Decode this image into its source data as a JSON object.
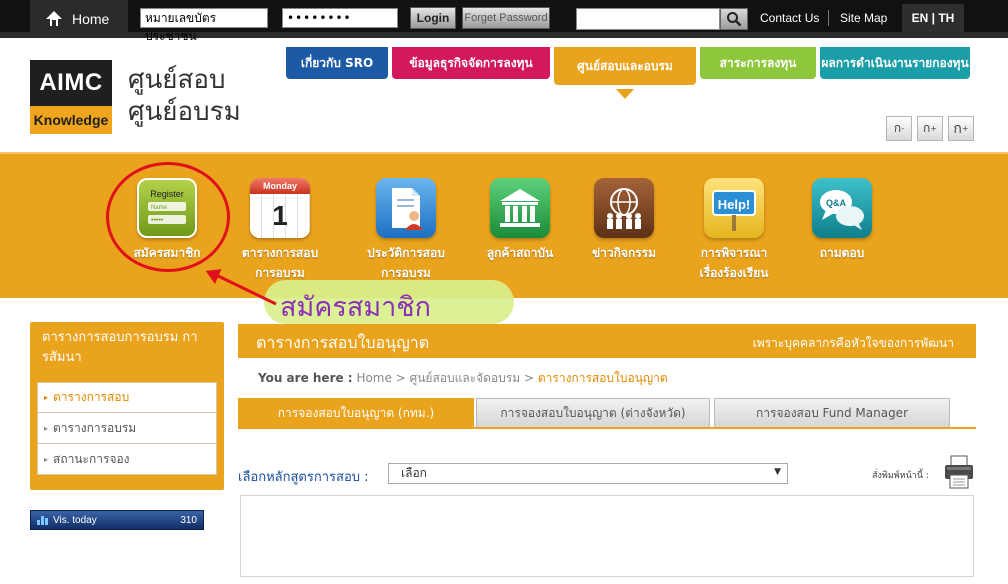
{
  "topbar": {
    "home_label": "Home",
    "id_input_value": "หมายเลขบัตรประชาชน",
    "password_value": "••••••••",
    "login_label": "Login",
    "forgot_label": "Forget Password",
    "search_value": "",
    "contact_label": "Contact Us",
    "sitemap_label": "Site Map",
    "lang_label": "EN | TH"
  },
  "header": {
    "logo_top": "AIMC",
    "logo_bottom": "Knowledge",
    "title_line1": "ศูนย์สอบ",
    "title_line2": "ศูนย์อบรม",
    "font_buttons": [
      "ก",
      "ก",
      "ก"
    ],
    "font_button_sup": [
      "-",
      "+",
      "+"
    ]
  },
  "nav": {
    "tabs": [
      {
        "label": "เกี่ยวกับ SRO",
        "color": "#1c5aa6"
      },
      {
        "label": "ข้อมูลธุรกิจจัดการลงทุน",
        "color": "#d3185c"
      },
      {
        "label": "ศูนย์สอบและอบรม",
        "color": "#eaa31d"
      },
      {
        "label": "สาระการลงทุน",
        "color": "#8ec73c"
      },
      {
        "label": "ผลการดำเนินงานรายกองทุน",
        "color": "#1b9ea8"
      }
    ]
  },
  "band": {
    "items": [
      {
        "label1": "สมัครสมาชิก",
        "label2": "",
        "icon": "register-icon",
        "icon_text": "Register",
        "icon_field1": "Name",
        "icon_field2": "•••••"
      },
      {
        "label1": "ตารางการสอบ",
        "label2": "การอบรม",
        "icon": "calendar-icon",
        "icon_text": "Monday",
        "icon_num": "1"
      },
      {
        "label1": "ประวัติการสอบ",
        "label2": "การอบรม",
        "icon": "history-document-icon"
      },
      {
        "label1": "ลูกค้าสถาบัน",
        "label2": "",
        "icon": "institution-icon"
      },
      {
        "label1": "ข่าวกิจกรรม",
        "label2": "",
        "icon": "globe-people-icon"
      },
      {
        "label1": "การพิจารณา",
        "label2": "เรื่องร้องเรียน",
        "icon": "help-sign-icon",
        "icon_text": "Help!"
      },
      {
        "label1": "ถามตอบ",
        "label2": "",
        "icon": "qa-chat-icon",
        "icon_text": "Q&A"
      }
    ],
    "annotation_text": "สมัครสมาชิก",
    "annotation_color": "#8b2fb6",
    "circle_color": "#e0101c"
  },
  "sidebar": {
    "title": "ตารางการสอบการอบรม การสัมนา",
    "items": [
      {
        "label": "ตารางการสอบ",
        "active": true
      },
      {
        "label": "ตารางการอบรม",
        "active": false
      },
      {
        "label": "สถานะการจอง",
        "active": false
      }
    ],
    "counter_label": "Vis. today",
    "counter_value": "310"
  },
  "main": {
    "title": "ตารางการสอบใบอนุญาต",
    "slogan": "เพราะบุคคลากรคือหัวใจของการพัฒนา",
    "breadcrumb": {
      "prefix": "You are here :",
      "items": [
        "Home",
        "ศูนย์สอบและจัดอบรม",
        "ตารางการสอบใบอนุญาต"
      ],
      "separator": ">"
    },
    "tabs": [
      {
        "label": "การจองสอบใบอนุญาต (กทม.)",
        "active": true
      },
      {
        "label": "การจองสอบใบอนุญาต (ต่างจังหวัด)",
        "active": false
      },
      {
        "label": "การจองสอบ Fund Manager",
        "active": false
      }
    ],
    "course_label": "เลือกหลักสูตรการสอบ :",
    "course_selected": "เลือก",
    "print_label": "สั่งพิมพ์หน้านี้ :"
  },
  "colors": {
    "accent_orange": "#eaa31d",
    "topbar_black": "#111111",
    "link_blue": "#1a4fa0"
  }
}
